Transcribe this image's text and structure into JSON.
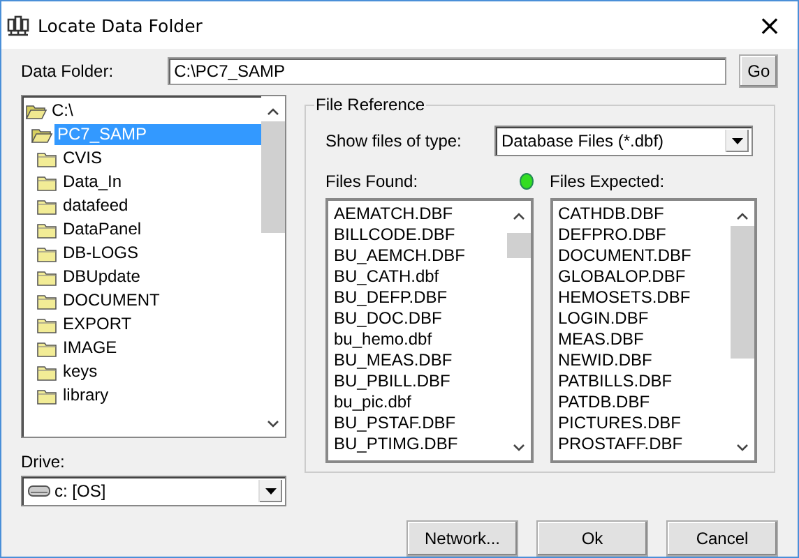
{
  "window": {
    "title": "Locate Data Folder",
    "close": "×"
  },
  "data_folder": {
    "label": "Data Folder:",
    "value": "C:\\PC7_SAMP",
    "go": "Go"
  },
  "folders": [
    {
      "name": "C:\\",
      "selected": false,
      "children": [
        {
          "name": "PC7_SAMP",
          "selected": true,
          "children": [
            {
              "name": "CVIS",
              "selected": false
            },
            {
              "name": "Data_In",
              "selected": false
            },
            {
              "name": "datafeed",
              "selected": false
            },
            {
              "name": "DataPanel",
              "selected": false
            },
            {
              "name": "DB-LOGS",
              "selected": false
            },
            {
              "name": "DBUpdate",
              "selected": false
            },
            {
              "name": "DOCUMENT",
              "selected": false
            },
            {
              "name": "EXPORT",
              "selected": false
            },
            {
              "name": "IMAGE",
              "selected": false
            },
            {
              "name": "keys",
              "selected": false
            },
            {
              "name": "library",
              "selected": false
            }
          ]
        }
      ]
    }
  ],
  "drive": {
    "label": "Drive:",
    "value": "c: [OS]"
  },
  "file_reference": {
    "title": "File Reference",
    "type_label": "Show files of type:",
    "type_value": "Database Files (*.dbf)",
    "found_label": "Files Found:",
    "all_found": true,
    "expected_label": "Files Expected:",
    "files_found": [
      "AEMATCH.DBF",
      "BILLCODE.DBF",
      "BU_AEMCH.DBF",
      "BU_CATH.dbf",
      "BU_DEFP.DBF",
      "BU_DOC.DBF",
      "bu_hemo.dbf",
      "BU_MEAS.DBF",
      "BU_PBILL.DBF",
      "bu_pic.dbf",
      "BU_PSTAF.DBF",
      "BU_PTIMG.DBF"
    ],
    "files_expected": [
      "CATHDB.DBF",
      "DEFPRO.DBF",
      "DOCUMENT.DBF",
      "GLOBALOP.DBF",
      "HEMOSETS.DBF",
      "LOGIN.DBF",
      "MEAS.DBF",
      "NEWID.DBF",
      "PATBILLS.DBF",
      "PATDB.DBF",
      "PICTURES.DBF",
      "PROSTAFF.DBF"
    ]
  },
  "buttons": [
    "Network...",
    "Ok",
    "Cancel"
  ]
}
